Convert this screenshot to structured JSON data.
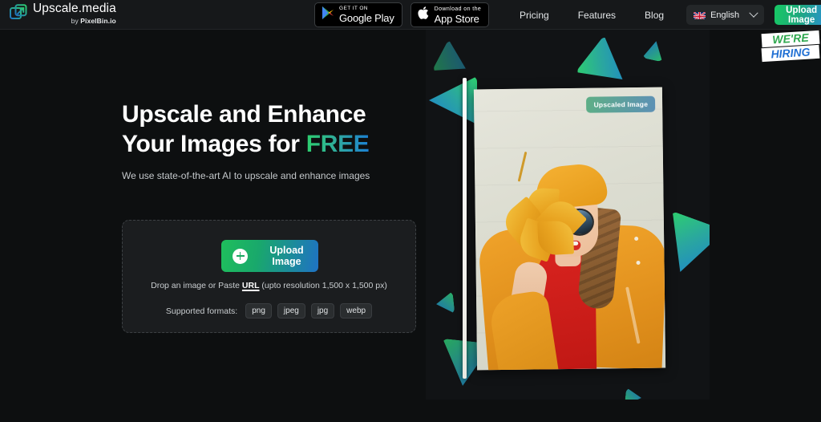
{
  "brand": {
    "name": "Upscale.media",
    "byline_prefix": "by ",
    "byline_company": "PixelBin.io",
    "logo_icon": "upscale-arrow-icon"
  },
  "header": {
    "store_badges": [
      {
        "icon": "google-play-icon",
        "small": "GET IT ON",
        "big": "Google Play"
      },
      {
        "icon": "apple-icon",
        "small": "Download on the",
        "big": "App Store"
      }
    ],
    "nav": [
      {
        "label": "Pricing"
      },
      {
        "label": "Features"
      },
      {
        "label": "Blog"
      }
    ],
    "language": {
      "flag_icon": "uk-flag-icon",
      "label": "English",
      "chevron_icon": "chevron-down-icon"
    },
    "upload_button": "Upload Image"
  },
  "hiring_badge": {
    "line1": "WE'RE",
    "line2": "HIRING",
    "color_line1": "#2fa84f",
    "color_line2": "#2271d4"
  },
  "hero": {
    "title_line1": "Upscale and Enhance",
    "title_line2_prefix": "Your Images for ",
    "title_highlight": "FREE",
    "subtitle": "We use state-of-the-art AI to upscale and enhance images"
  },
  "dropzone": {
    "button_label": "Upload Image",
    "button_icon": "plus-circle-icon",
    "drop_text_before": "Drop an image or Paste ",
    "drop_link": "URL",
    "drop_text_after": " (upto resolution 1,500 x 1,500 px)",
    "formats_label": "Supported formats:",
    "formats": [
      "png",
      "jpeg",
      "jpg",
      "webp"
    ]
  },
  "preview": {
    "badge_label": "Upscaled Image",
    "slider_handle": "comparison-slider",
    "image_alt": "woman-with-leaf-photo"
  },
  "colors": {
    "background": "#0d0f10",
    "header_bg": "#16181a",
    "accent_green": "#1fbf5c",
    "accent_blue": "#1f72c4",
    "panel_bg": "#111315"
  }
}
